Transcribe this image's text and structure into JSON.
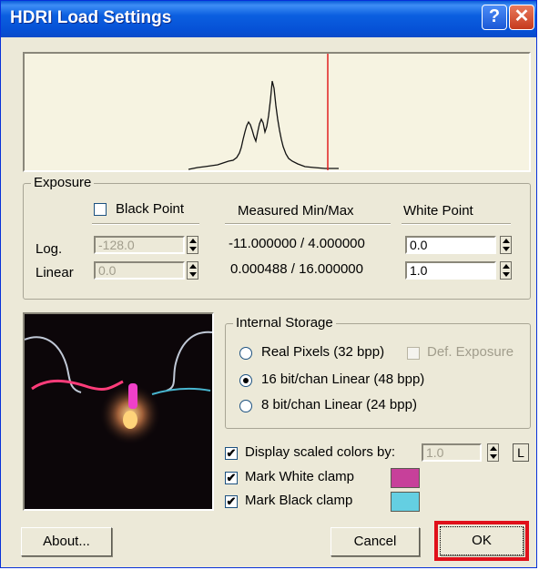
{
  "window": {
    "title": "HDRI Load Settings",
    "help_glyph": "?",
    "close_glyph": "✕"
  },
  "exposure": {
    "group_label": "Exposure",
    "black_point_label": "Black Point",
    "black_point_checked": false,
    "measured_label": "Measured Min/Max",
    "white_point_label": "White Point",
    "log_label": "Log.",
    "linear_label": "Linear",
    "black_log_value": "-128.0",
    "black_linear_value": "0.0",
    "measured_log": "-11.000000 / 4.000000",
    "measured_linear": "0.000488 / 16.000000",
    "white_log_value": "0.0",
    "white_linear_value": "1.0"
  },
  "storage": {
    "group_label": "Internal Storage",
    "options": [
      {
        "label": "Real Pixels (32 bpp)",
        "selected": false
      },
      {
        "label": "16 bit/chan Linear (48 bpp)",
        "selected": true
      },
      {
        "label": "8 bit/chan Linear (24 bpp)",
        "selected": false
      }
    ],
    "def_exposure_label": "Def. Exposure",
    "def_exposure_enabled": false
  },
  "display": {
    "scaled_label": "Display scaled colors by:",
    "scaled_checked": true,
    "scaled_value": "1.0",
    "l_button": "L",
    "white_clamp_label": "Mark White clamp",
    "white_clamp_checked": true,
    "white_clamp_color": "#c7409a",
    "black_clamp_label": "Mark Black clamp",
    "black_clamp_checked": true,
    "black_clamp_color": "#64cfe2"
  },
  "buttons": {
    "about": "About...",
    "cancel": "Cancel",
    "ok": "OK"
  },
  "colors": {
    "title_bar": "#0651d6",
    "histogram_bg": "#f6f3e1",
    "white_point_marker": "#e02020",
    "highlight": "#e0101a"
  },
  "check_glyph": "✔"
}
